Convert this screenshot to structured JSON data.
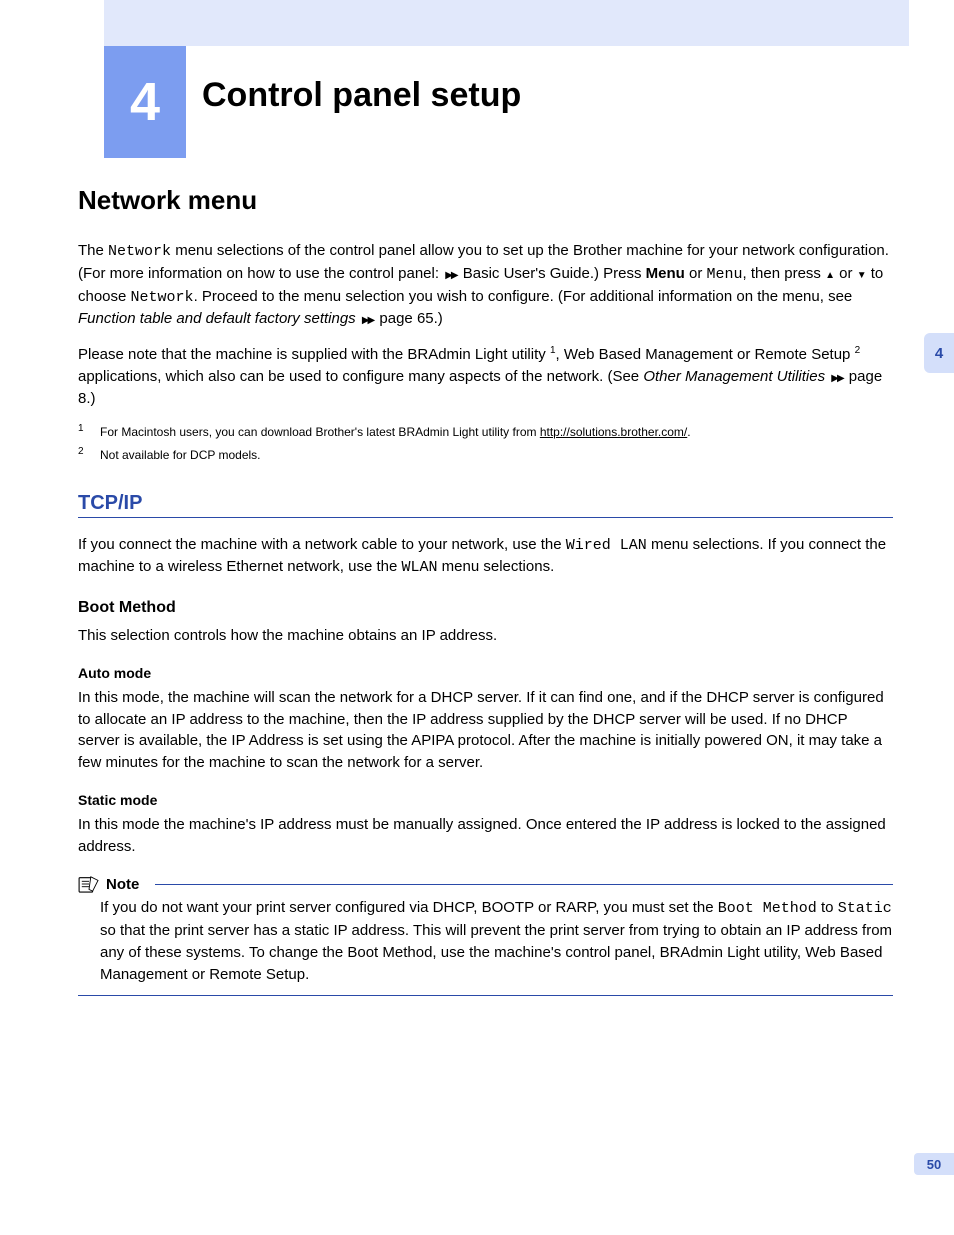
{
  "chapter": {
    "number": "4",
    "title": "Control panel setup",
    "sideTab": "4",
    "pageNum": "50"
  },
  "section": {
    "networkMenu": {
      "title": "Network menu",
      "p1a": "The ",
      "p1mono1": "Network",
      "p1b": " menu selections of the control panel allow you to set up the Brother machine for your network configuration. (For more information on how to use the control panel: ",
      "p1c": " Basic User's Guide.) Press ",
      "p1bold1": "Menu",
      "p1d": " or ",
      "p1mono2": "Menu",
      "p1e": ", then press ",
      "p1f": " or ",
      "p1g": " to choose ",
      "p1mono3": "Network",
      "p1h": ". Proceed to the menu selection you wish to configure. (For additional information on the menu, see ",
      "p1italic": "Function table and default factory settings",
      "p1i": " page 65.)",
      "p2a": "Please note that the machine is supplied with the BRAdmin Light utility ",
      "p2b": ", Web Based Management or Remote Setup ",
      "p2c": " applications, which also can be used to configure many aspects of the network. (See ",
      "p2italic": "Other Management Utilities",
      "p2d": " page 8.)",
      "fn1num": "1",
      "fn1": "For Macintosh users, you can download Brother's latest BRAdmin Light utility from ",
      "fn1link": "http://solutions.brother.com/",
      "fn1end": ".",
      "fn2num": "2",
      "fn2": "Not available for DCP models."
    },
    "tcpip": {
      "title": "TCP/IP",
      "p1a": "If you connect the machine with a network cable to your network, use the ",
      "p1mono1": "Wired LAN",
      "p1b": " menu selections. If you connect the machine to a wireless Ethernet network, use the ",
      "p1mono2": "WLAN",
      "p1c": " menu selections.",
      "bootMethod": {
        "title": "Boot Method",
        "p1": "This selection controls how the machine obtains an IP address.",
        "auto": {
          "title": "Auto mode",
          "p1": "In this mode, the machine will scan the network for a DHCP server. If it can find one, and if the DHCP server is configured to allocate an IP address to the machine, then the IP address supplied by the DHCP server will be used. If no DHCP server is available, the IP Address is set using the APIPA protocol. After the machine is initially powered ON, it may take a few minutes for the machine to scan the network for a server."
        },
        "static": {
          "title": "Static mode",
          "p1": "In this mode the machine's IP address must be manually assigned. Once entered the IP address is locked to the assigned address."
        }
      },
      "note": {
        "label": "Note",
        "p1a": "If you do not want your print server configured via DHCP, BOOTP or RARP, you must set the ",
        "mono1": "Boot Method",
        "p1b": " to ",
        "mono2": "Static",
        "p1c": " so that the print server has a static IP address. This will prevent the print server from trying to obtain an IP address from any of these systems. To change the Boot Method, use the machine's control panel, BRAdmin Light utility, Web Based Management or Remote Setup."
      }
    }
  }
}
